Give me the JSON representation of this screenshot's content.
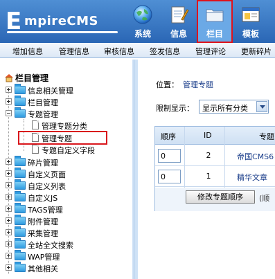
{
  "app": {
    "logo_initial": "E",
    "logo_text": "mpireCMS"
  },
  "nav": [
    {
      "label": "系统",
      "icon": "globe-icon"
    },
    {
      "label": "信息",
      "icon": "notepad-icon"
    },
    {
      "label": "栏目",
      "icon": "folder-icon",
      "active": true
    },
    {
      "label": "模板",
      "icon": "window-icon"
    }
  ],
  "submenu": [
    "增加信息",
    "管理信息",
    "审核信息",
    "签发信息",
    "管理评论",
    "更新碎片"
  ],
  "tree": {
    "root": "栏目管理",
    "items": [
      {
        "label": "信息相关管理",
        "expanded": false
      },
      {
        "label": "栏目管理",
        "expanded": false
      },
      {
        "label": "专题管理",
        "expanded": true,
        "children": [
          "管理专题分类",
          "管理专题",
          "专题自定义字段"
        ]
      },
      {
        "label": "碎片管理",
        "expanded": false
      },
      {
        "label": "自定义页面",
        "expanded": false
      },
      {
        "label": "自定义列表",
        "expanded": false
      },
      {
        "label": "自定义JS",
        "expanded": false
      },
      {
        "label": "TAGS管理",
        "expanded": false
      },
      {
        "label": "附件管理",
        "expanded": false
      },
      {
        "label": "采集管理",
        "expanded": false
      },
      {
        "label": "全站全文搜索",
        "expanded": false
      },
      {
        "label": "WAP管理",
        "expanded": false
      },
      {
        "label": "其他相关",
        "expanded": false
      }
    ],
    "highlighted": "管理专题"
  },
  "content": {
    "position_label": "位置：",
    "position_link": "管理专题",
    "filter_label": "限制显示：",
    "filter_value": "显示所有分类",
    "table": {
      "headers": [
        "顺序",
        "ID",
        "专题"
      ],
      "rows": [
        {
          "order": "0",
          "id": "2",
          "name": "帝国CMS6"
        },
        {
          "order": "0",
          "id": "1",
          "name": "精华文章"
        }
      ],
      "button": "修改专题顺序",
      "note": "(顺"
    }
  },
  "colors": {
    "header_blue": "#2a66b5",
    "active_border": "#e0121b",
    "link": "#1a3d8a"
  }
}
